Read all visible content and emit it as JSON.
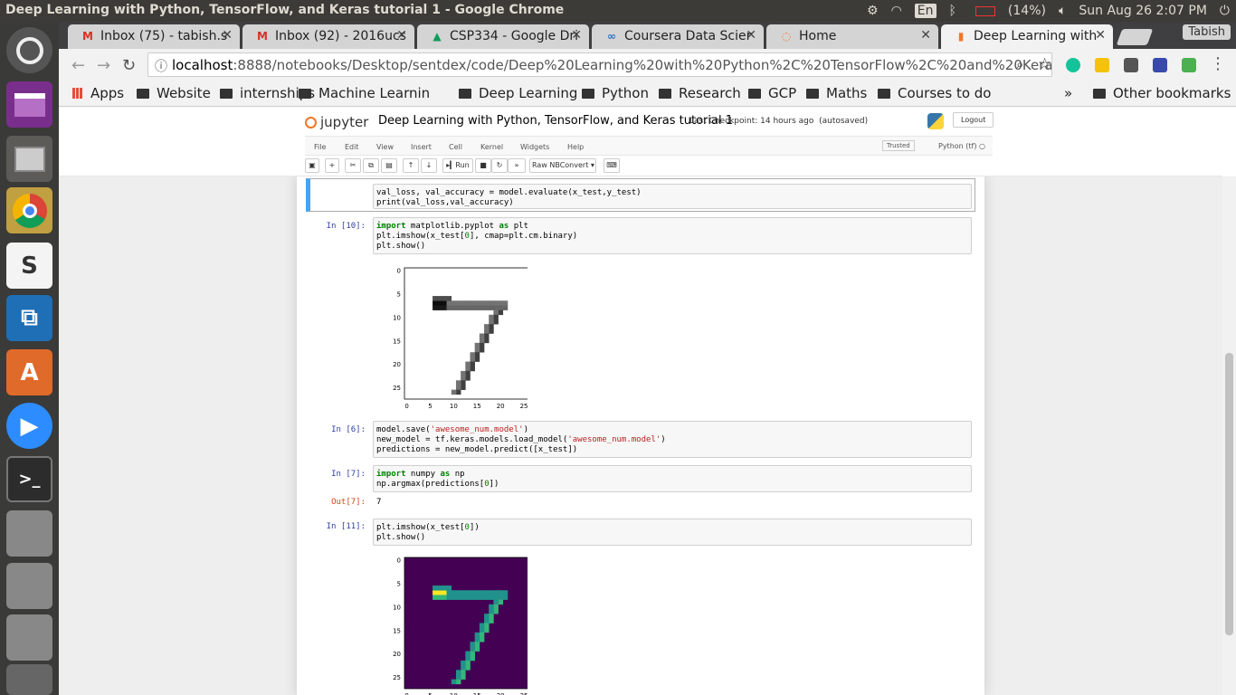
{
  "os": {
    "window_title": "Deep Learning with Python, TensorFlow, and Keras tutorial 1 - Google Chrome",
    "keyboard": "En",
    "battery": "(14%)",
    "datetime": "Sun Aug 26  2:07 PM"
  },
  "browser": {
    "tabs": [
      {
        "label": "Inbox (75) - tabish.s",
        "icon": "gmail-icon"
      },
      {
        "label": "Inbox (92) - 2016ucs",
        "icon": "gmail-icon"
      },
      {
        "label": "CSP334 - Google Dri",
        "icon": "drive-icon"
      },
      {
        "label": "Coursera Data Scier",
        "icon": "coursera-icon"
      },
      {
        "label": "Home",
        "icon": "jupyter-icon"
      },
      {
        "label": "Deep Learning with",
        "icon": "jupyter-icon"
      }
    ],
    "profile": "Tabish",
    "url_host": "localhost",
    "url_rest": ":8888/notebooks/Desktop/sentdex/code/Deep%20Learning%20with%20Python%2C%20TensorFlow%2C%20and%20Keras%20tutori...",
    "bookmarks": [
      "Apps",
      "Website",
      "internships",
      "Machine Learnin",
      "Deep Learning",
      "Python",
      "Research",
      "GCP",
      "Maths",
      "Courses to do"
    ],
    "more": "»",
    "other_bookmarks": "Other bookmarks"
  },
  "jupyter": {
    "logo": "jupyter",
    "notebook_name": "Deep Learning with Python, TensorFlow, and Keras tutorial 1",
    "checkpoint": "Last Checkpoint: 14 hours ago",
    "autosaved": "(autosaved)",
    "logout": "Logout",
    "menu": [
      "File",
      "Edit",
      "View",
      "Insert",
      "Cell",
      "Kernel",
      "Widgets",
      "Help"
    ],
    "trusted": "Trusted",
    "kernel": "Python (tf)",
    "run": "Run",
    "cell_type": "Raw NBConvert"
  },
  "cells": {
    "c1": {
      "prompt": "",
      "lines": [
        "val_loss, val_accuracy = model.evaluate(x_test,y_test)",
        "print(val_loss,val_accuracy)"
      ]
    },
    "c2": {
      "prompt": "In [10]:"
    },
    "c3": {
      "prompt": "In [6]:"
    },
    "c4": {
      "prompt": "In [7]:",
      "out_prompt": "Out[7]:",
      "output": "7"
    },
    "c5": {
      "prompt": "In [11]:"
    }
  },
  "plots": {
    "ticks": [
      "0",
      "5",
      "10",
      "15",
      "20",
      "25"
    ]
  }
}
